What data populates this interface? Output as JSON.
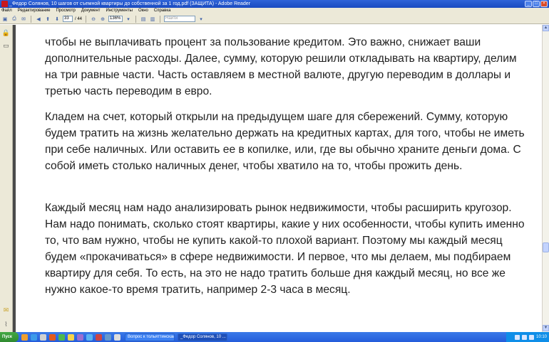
{
  "window": {
    "title": "_Федор Солянов, 10 шагов от съемной квартиры до собственной за 1 год.pdf (ЗАЩИТА) - Adobe Reader"
  },
  "menu": [
    "Файл",
    "Редактирование",
    "Просмотр",
    "Документ",
    "Инструменты",
    "Окно",
    "Справка"
  ],
  "toolbar": {
    "page_current": "33",
    "page_total": "/ 44",
    "zoom": "136%",
    "find_placeholder": "Найти"
  },
  "document": {
    "paragraphs": [
      "чтобы не выплачивать процент за пользование кредитом. Это важно, снижает ваши дополнительные расходы.  Далее, сумму, которую решили откладывать на квартиру, делим на три равные части. Часть оставляем в местной валюте, другую переводим в доллары и третью часть переводим в евро.",
      "Кладем на счет, который открыли на предыдущем шаге для сбережений. Сумму, которую будем тратить на жизнь желательно держать на кредитных картах, для того, чтобы не иметь при себе наличных. Или оставить ее в копилке, или, где вы обычно храните деньги дома. С собой иметь столько наличных денег, чтобы хватило на то, чтобы прожить день.",
      "Каждый месяц нам надо анализировать рынок недвижимости, чтобы расширить кругозор. Нам надо понимать, сколько стоят квартиры, какие у них особенности, чтобы купить именно то, что вам нужно, чтобы не купить какой-то плохой вариант. Поэтому мы каждый месяц будем «прокачиваться» в сфере недвижимости. И первое, что мы делаем, мы подбираем квартиру для себя. То есть, на это не надо тратить больше дня каждый месяц, но все же нужно какое-то время тратить, например 2-3 часа в месяц."
    ]
  },
  "taskbar": {
    "start_label": "Пуск",
    "tasks": [
      "Вопрос к тольяттинскаи...",
      "_Федор Солянов, 10 ..."
    ],
    "clock": "10:10"
  }
}
